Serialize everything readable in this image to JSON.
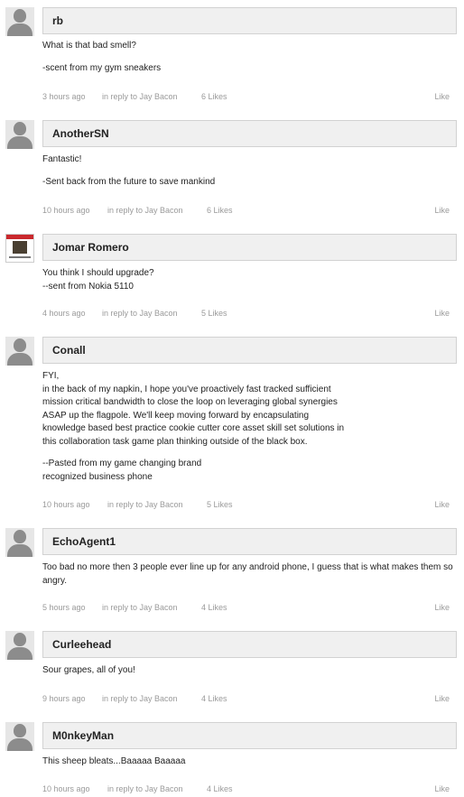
{
  "comments": [
    {
      "author": "rb",
      "paragraphs": [
        " What is that bad smell?",
        "-scent from my gym sneakers"
      ],
      "time": "3 hours ago",
      "reply": "in reply to Jay Bacon",
      "likes": "6 Likes",
      "like_label": "Like",
      "avatar": "default-avatar-icon"
    },
    {
      "author": "AnotherSN",
      "paragraphs": [
        "Fantastic!",
        "-Sent back from the future to save mankind"
      ],
      "time": "10 hours ago",
      "reply": "in reply to Jay Bacon",
      "likes": "6 Likes",
      "like_label": "Like",
      "avatar": "default-avatar-icon"
    },
    {
      "author": "Jomar Romero",
      "paragraphs": [
        "You think I should upgrade?\n--sent from Nokia 5110"
      ],
      "time": "4 hours ago",
      "reply": "in reply to Jay Bacon",
      "likes": "5 Likes",
      "like_label": "Like",
      "avatar": "user-photo-avatar"
    },
    {
      "author": "Conall",
      "paragraphs": [
        "FYI,\nin the back of my napkin, I hope you've proactively fast tracked sufficient\nmission critical bandwidth to close the loop on leveraging global synergies\nASAP up the flagpole.  We'll keep moving forward by encapsulating\nknowledge based best practice cookie cutter core asset skill set solutions in\nthis collaboration task game plan thinking outside of the black box.",
        "--Pasted from my game changing brand\nrecognized business phone"
      ],
      "time": "10 hours ago",
      "reply": "in reply to Jay Bacon",
      "likes": "5 Likes",
      "like_label": "Like",
      "avatar": "default-avatar-icon"
    },
    {
      "author": "EchoAgent1",
      "paragraphs": [
        "Too bad no more then 3 people ever line up for any android phone, I guess that is what  makes them so angry."
      ],
      "time": "5 hours ago",
      "reply": "in reply to Jay Bacon",
      "likes": "4 Likes",
      "like_label": "Like",
      "avatar": "default-avatar-icon"
    },
    {
      "author": "Curleehead",
      "paragraphs": [
        "Sour grapes, all of you!"
      ],
      "time": "9 hours ago",
      "reply": "in reply to Jay Bacon",
      "likes": "4 Likes",
      "like_label": "Like",
      "avatar": "default-avatar-icon"
    },
    {
      "author": "M0nkeyMan",
      "paragraphs": [
        "This sheep bleats...Baaaaa Baaaaa"
      ],
      "time": "10 hours ago",
      "reply": "in reply to Jay Bacon",
      "likes": "4 Likes",
      "like_label": "Like",
      "avatar": "default-avatar-icon"
    }
  ]
}
